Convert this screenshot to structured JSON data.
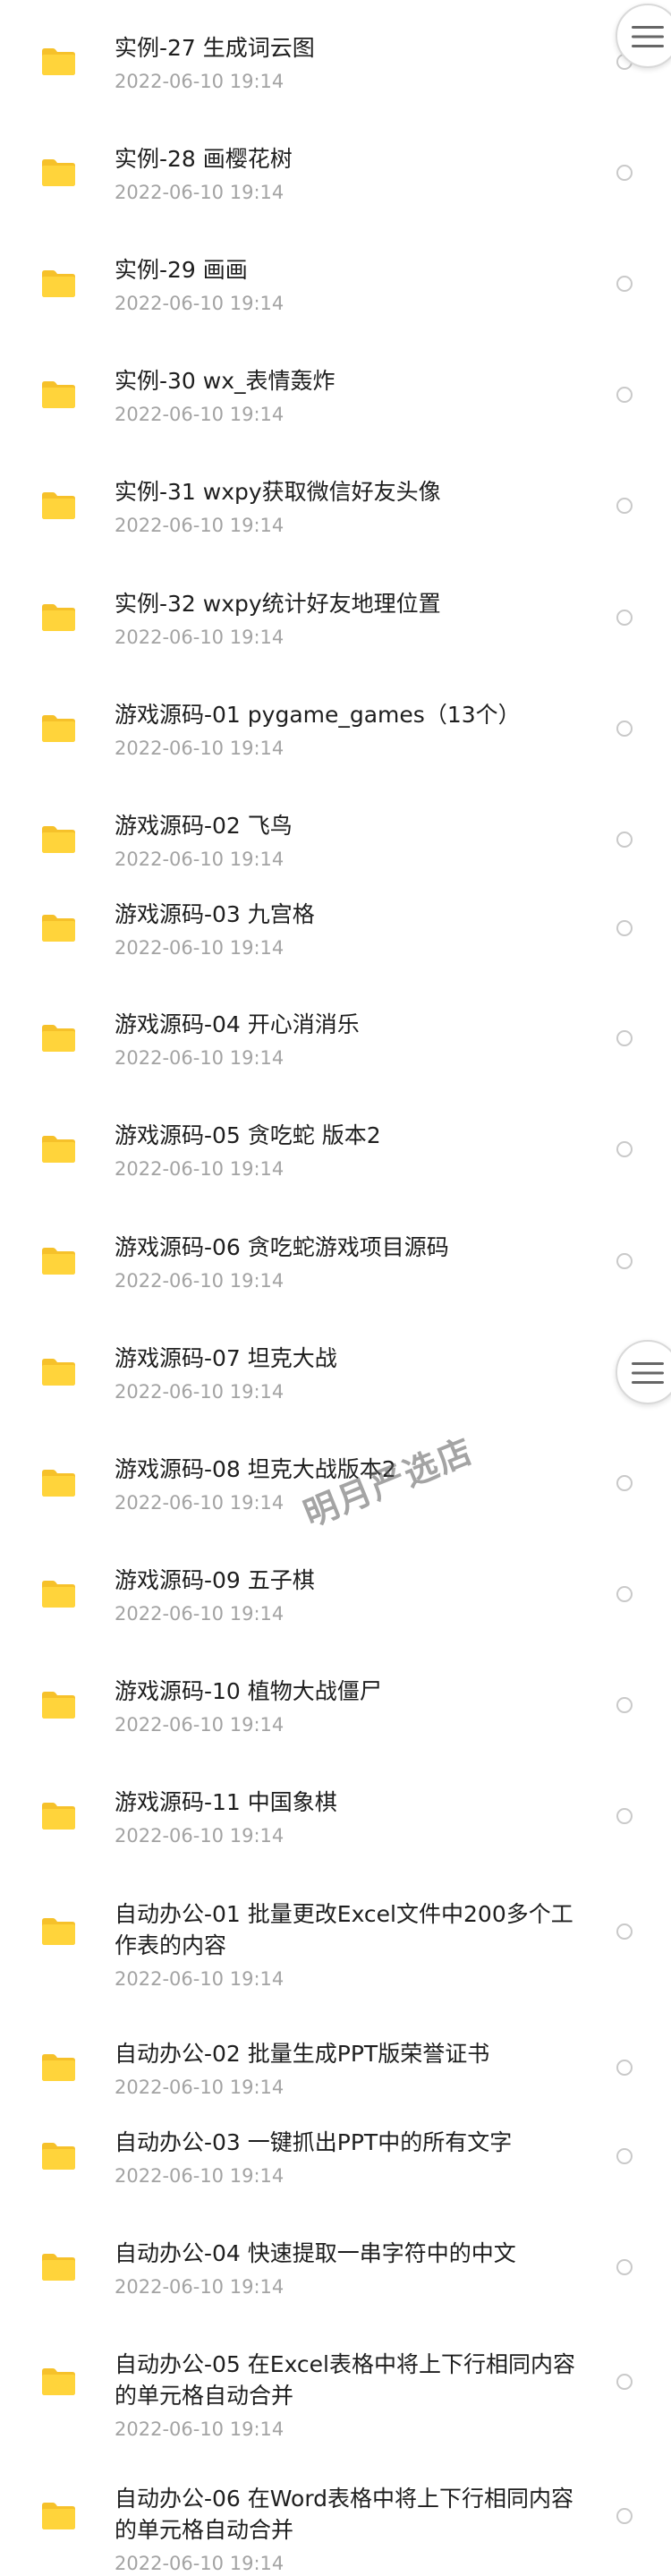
{
  "files": [
    {
      "name": "实例-27 生成词云图",
      "date": "2022-06-10  19:14"
    },
    {
      "name": "实例-28 画樱花树",
      "date": "2022-06-10  19:14"
    },
    {
      "name": "实例-29 画画",
      "date": "2022-06-10  19:14"
    },
    {
      "name": "实例-30 wx_表情轰炸",
      "date": "2022-06-10  19:14"
    },
    {
      "name": "实例-31 wxpy获取微信好友头像",
      "date": "2022-06-10  19:14"
    },
    {
      "name": "实例-32 wxpy统计好友地理位置",
      "date": "2022-06-10  19:14"
    },
    {
      "name": "游戏源码-01 pygame_games（13个）",
      "date": "2022-06-10  19:14"
    },
    {
      "name": "游戏源码-02 飞鸟",
      "date": "2022-06-10  19:14"
    },
    {
      "name": "游戏源码-03 九宫格",
      "date": "2022-06-10  19:14"
    },
    {
      "name": "游戏源码-04 开心消消乐",
      "date": "2022-06-10  19:14"
    },
    {
      "name": "游戏源码-05 贪吃蛇 版本2",
      "date": "2022-06-10  19:14"
    },
    {
      "name": "游戏源码-06 贪吃蛇游戏项目源码",
      "date": "2022-06-10  19:14"
    },
    {
      "name": "游戏源码-07 坦克大战",
      "date": "2022-06-10  19:14"
    },
    {
      "name": "游戏源码-08 坦克大战版本2",
      "date": "2022-06-10  19:14"
    },
    {
      "name": "游戏源码-09 五子棋",
      "date": "2022-06-10  19:14"
    },
    {
      "name": "游戏源码-10 植物大战僵尸",
      "date": "2022-06-10  19:14"
    },
    {
      "name": "游戏源码-11 中国象棋",
      "date": "2022-06-10  19:14"
    },
    {
      "name": "自动办公-01 批量更改Excel文件中200多个工作表的内容",
      "date": "2022-06-10  19:14"
    },
    {
      "name": "自动办公-02 批量生成PPT版荣誉证书",
      "date": "2022-06-10  19:14"
    },
    {
      "name": "自动办公-03 一键抓出PPT中的所有文字",
      "date": "2022-06-10  19:14"
    },
    {
      "name": "自动办公-04 快速提取一串字符中的中文",
      "date": "2022-06-10  19:14"
    },
    {
      "name": "自动办公-05 在Excel表格中将上下行相同内容的单元格自动合并",
      "date": "2022-06-10  19:14"
    },
    {
      "name": "自动办公-06 在Word表格中将上下行相同内容的单元格自动合并",
      "date": "2022-06-10  19:14"
    }
  ],
  "watermark": "明月严选店",
  "icons": {
    "folder": "folder-icon",
    "menu": "menu-icon"
  },
  "colors": {
    "folder": "#ffd43b",
    "text": "#1e1e1e",
    "date": "#a3a3a3"
  }
}
